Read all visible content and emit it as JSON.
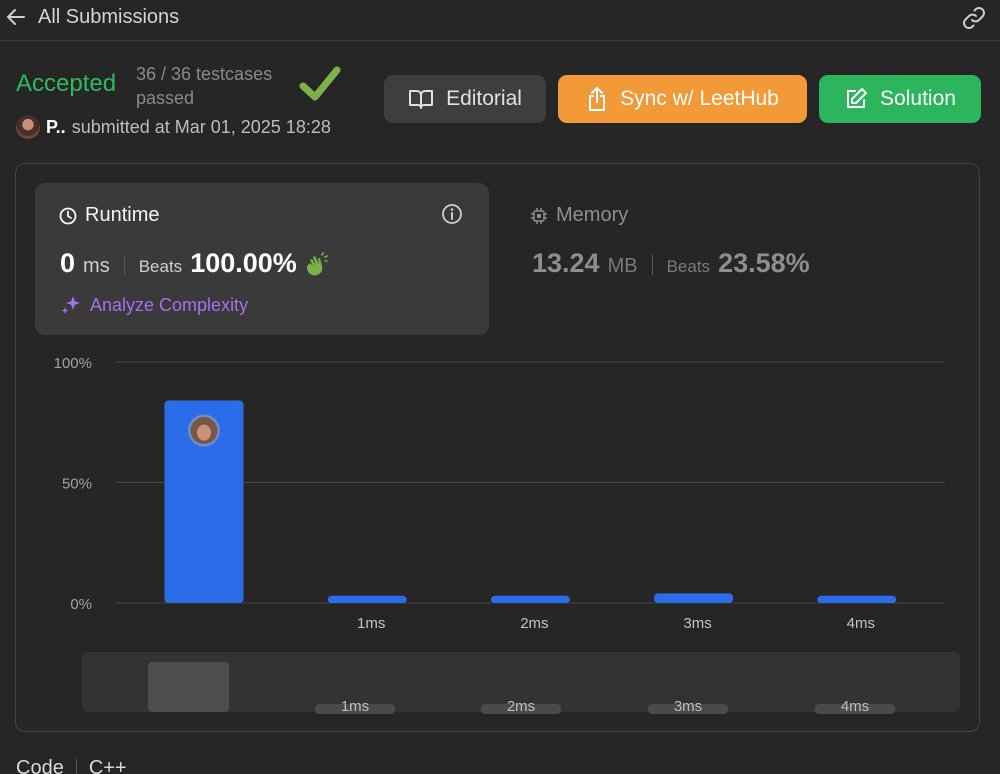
{
  "nav": {
    "back_label": "All Submissions",
    "back_icon": "arrow-left-icon",
    "share_icon": "link-icon"
  },
  "status": {
    "title": "Accepted",
    "testcases": "36 / 36 testcases passed",
    "color": "#2cbb5d"
  },
  "submitter": {
    "name": "P..",
    "text": "submitted at Mar 01, 2025 18:28"
  },
  "buttons": {
    "editorial": "Editorial",
    "sync": "Sync w/ LeetHub",
    "solution": "Solution"
  },
  "runtime": {
    "title": "Runtime",
    "value": "0",
    "unit": "ms",
    "beats_label": "Beats",
    "beats_value": "100.00%",
    "analyze_label": "Analyze Complexity"
  },
  "memory": {
    "title": "Memory",
    "value": "13.24",
    "unit": "MB",
    "beats_label": "Beats",
    "beats_value": "23.58%"
  },
  "colors": {
    "accepted": "#2cbb5d",
    "sync": "#f19a37",
    "solution": "#2cb55d",
    "bar": "#2b6de8",
    "analyze": "#a76ff0"
  },
  "bottom_tabs": {
    "code": "Code",
    "lang": "C++"
  },
  "chart_data": {
    "type": "bar",
    "categories": [
      "0ms",
      "1ms",
      "2ms",
      "3ms",
      "4ms"
    ],
    "tick_labels": [
      "",
      "1ms",
      "2ms",
      "3ms",
      "4ms"
    ],
    "values": [
      84,
      3,
      3,
      4,
      3
    ],
    "y_ticks": [
      "100%",
      "50%",
      "0%"
    ],
    "ylim": [
      0,
      100
    ],
    "highlight_index": 0,
    "grid": true,
    "navigator": {
      "tick_labels": [
        "1ms",
        "2ms",
        "3ms",
        "4ms"
      ]
    }
  }
}
